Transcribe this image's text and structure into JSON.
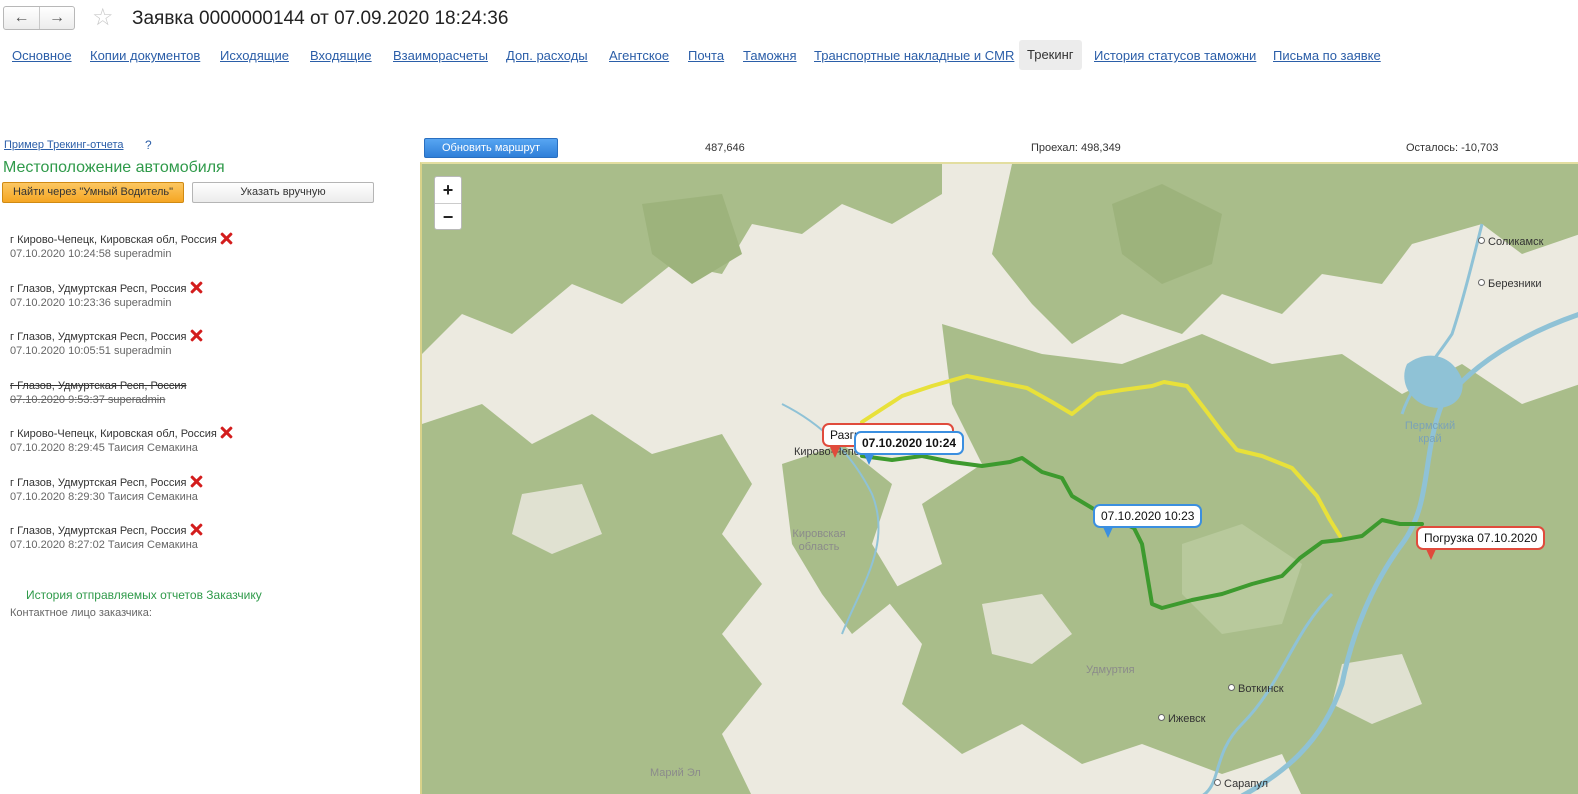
{
  "header": {
    "back_label": "←",
    "forward_label": "→",
    "favorite_icon": "☆",
    "title": "Заявка 0000000144 от 07.09.2020 18:24:36"
  },
  "tabs": [
    {
      "label": "Основное",
      "active": false
    },
    {
      "label": "Копии документов",
      "active": false
    },
    {
      "label": "Исходящие",
      "active": false
    },
    {
      "label": "Входящие",
      "active": false
    },
    {
      "label": "Взаиморасчеты",
      "active": false
    },
    {
      "label": "Доп. расходы",
      "active": false
    },
    {
      "label": "Агентское",
      "active": false
    },
    {
      "label": "Почта",
      "active": false
    },
    {
      "label": "Таможня",
      "active": false
    },
    {
      "label": "Транспортные накладные и CMR",
      "active": false
    },
    {
      "label": "Трекинг",
      "active": true
    },
    {
      "label": "История статусов таможни",
      "active": false
    },
    {
      "label": "Письма по заявке",
      "active": false
    }
  ],
  "left": {
    "example_link": "Пример Трекинг-отчета",
    "help": "?",
    "location_header": "Местоположение автомобиля",
    "find_button": "Найти через \"Умный Водитель\"",
    "manual_button": "Указать вручную",
    "locations": [
      {
        "place": "г Кирово-Чепецк,  Кировская обл, Россия",
        "meta": "07.10.2020 10:24:58 superadmin",
        "struck": false
      },
      {
        "place": "г Глазов,  Удмуртская Респ, Россия",
        "meta": "07.10.2020 10:23:36 superadmin",
        "struck": false
      },
      {
        "place": "г Глазов,  Удмуртская Респ, Россия",
        "meta": "07.10.2020 10:05:51 superadmin",
        "struck": false
      },
      {
        "place": "г Глазов,  Удмуртская Респ, Россия",
        "meta": "07.10.2020 9:53:37 superadmin",
        "struck": true
      },
      {
        "place": "г Кирово-Чепецк,  Кировская обл, Россия",
        "meta": "07.10.2020 8:29:45 Таисия Семакина",
        "struck": false
      },
      {
        "place": "г Глазов,  Удмуртская Респ, Россия",
        "meta": "07.10.2020 8:29:30 Таисия Семакина",
        "struck": false
      },
      {
        "place": "г Глазов,  Удмуртская Респ, Россия",
        "meta": "07.10.2020 8:27:02 Таисия Семакина",
        "struck": false
      }
    ],
    "history_title": "История отправляемых отчетов Заказчику",
    "contact_label": "Контактное лицо заказчика:"
  },
  "toolbar": {
    "update_route": "Обновить маршрут",
    "total": "487,646",
    "travelled": "Проехал: 498,349",
    "remaining": "Осталось: -10,703"
  },
  "map": {
    "zoom_in": "+",
    "zoom_out": "−",
    "cities": {
      "solikamsk": "Соликамск",
      "berezniki": "Березники",
      "kirovo_chepetsk": "Кирово-Чепецк",
      "votkinsk": "Воткинск",
      "izhevsk": "Ижевск",
      "sarapul": "Сарапул"
    },
    "regions": {
      "perm": "Пермский край",
      "kirov": "Кировская область",
      "udmurtia": "Удмуртия",
      "mari_el": "Марий Эл"
    },
    "markers": {
      "unload": "Разгрузка",
      "current": "07.10.2020 10:24",
      "intermediate": "07.10.2020 10:23",
      "load": "Погрузка 07.10.2020"
    },
    "colors": {
      "planned_route": "#e8e13a",
      "travelled_route": "#3d9a2e",
      "forest": "#a9bd8a",
      "water": "#8fc2d6",
      "marker_blue": "#3b8fe0",
      "marker_red": "#e04b3c"
    }
  }
}
